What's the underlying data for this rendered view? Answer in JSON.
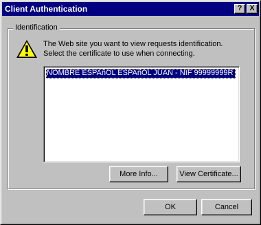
{
  "window": {
    "title": "Client Authentication",
    "help_label": "?",
    "close_label": "X"
  },
  "group": {
    "label": "Identification",
    "message_line1": "The Web site you want to view requests identification.",
    "message_line2": "Select the certificate to use when connecting.",
    "warning_icon": "warning-icon",
    "certificates": [
      "NOMBRE ESPAñOL ESPAñOL JUAN - NIF 99999999R"
    ]
  },
  "buttons": {
    "more_info": "More Info...",
    "view_certificate": "View Certificate...",
    "ok": "OK",
    "cancel": "Cancel"
  },
  "colors": {
    "titlebar": "#000080",
    "face": "#c0c0c0",
    "selection": "#000080"
  }
}
